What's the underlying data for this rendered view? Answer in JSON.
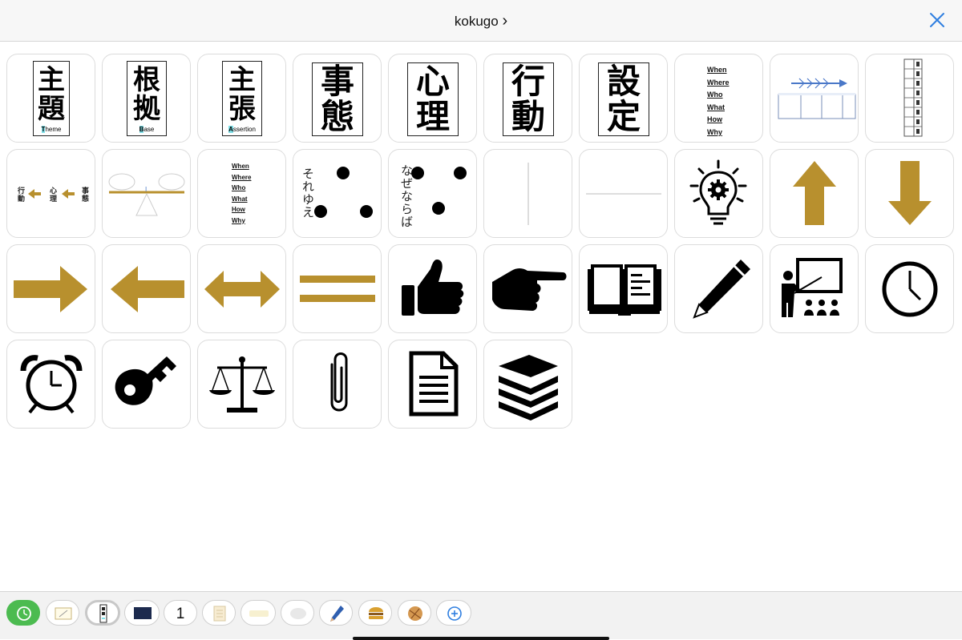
{
  "header": {
    "title": "kokugo",
    "title_chevron": "›",
    "close_icon": "close-icon",
    "accent": "#2f7fe0"
  },
  "cards": {
    "shudai": {
      "kanji_top": "主",
      "kanji_bottom": "題",
      "sub_first": "T",
      "sub_rest": "heme"
    },
    "konkyo": {
      "kanji_top": "根",
      "kanji_bottom": "拠",
      "sub_first": "B",
      "sub_rest": "ase"
    },
    "shucho": {
      "kanji_top": "主",
      "kanji_bottom": "張",
      "sub_first": "A",
      "sub_rest": "ssertion"
    },
    "jitai": {
      "kanji_top": "事",
      "kanji_bottom": "態"
    },
    "shinri": {
      "kanji_top": "心",
      "kanji_bottom": "理"
    },
    "kodo": {
      "kanji_top": "行",
      "kanji_bottom": "動"
    },
    "settei": {
      "kanji_top": "設",
      "kanji_bottom": "定"
    }
  },
  "wh_list": [
    "When",
    "Where",
    "Who",
    "What",
    "How",
    "Why"
  ],
  "flow": {
    "left": "行動",
    "middle": "心理",
    "right": "事態"
  },
  "connectors": {
    "sorekara": "それゆえ",
    "nazenaraba": "なぜならば"
  },
  "icons": [
    "lightbulb-gear-icon",
    "arrow-up-icon",
    "arrow-down-icon",
    "arrow-right-icon",
    "arrow-left-icon",
    "arrow-left-right-icon",
    "equals-icon",
    "thumbs-up-icon",
    "pointing-hand-icon",
    "open-book-icon",
    "pencil-icon",
    "teacher-presentation-icon",
    "clock-icon",
    "alarm-clock-icon",
    "key-icon",
    "balance-scale-icon",
    "paperclip-icon",
    "document-icon",
    "book-stack-icon"
  ],
  "colors": {
    "gold": "#b8902e",
    "black": "#111111",
    "teal_highlight": "#7fe0e8",
    "active_green": "#4cbb50"
  },
  "toolbar": {
    "page_number": "1",
    "items": [
      "clock-icon",
      "pen-frame-icon",
      "card-thumbnail-icon",
      "navy-swatch-icon",
      "page-number-button",
      "paper-icon",
      "sticky-icon",
      "cloud-icon",
      "pen-tool-icon",
      "burger-icon",
      "globe-icon",
      "add-circle-icon"
    ]
  }
}
